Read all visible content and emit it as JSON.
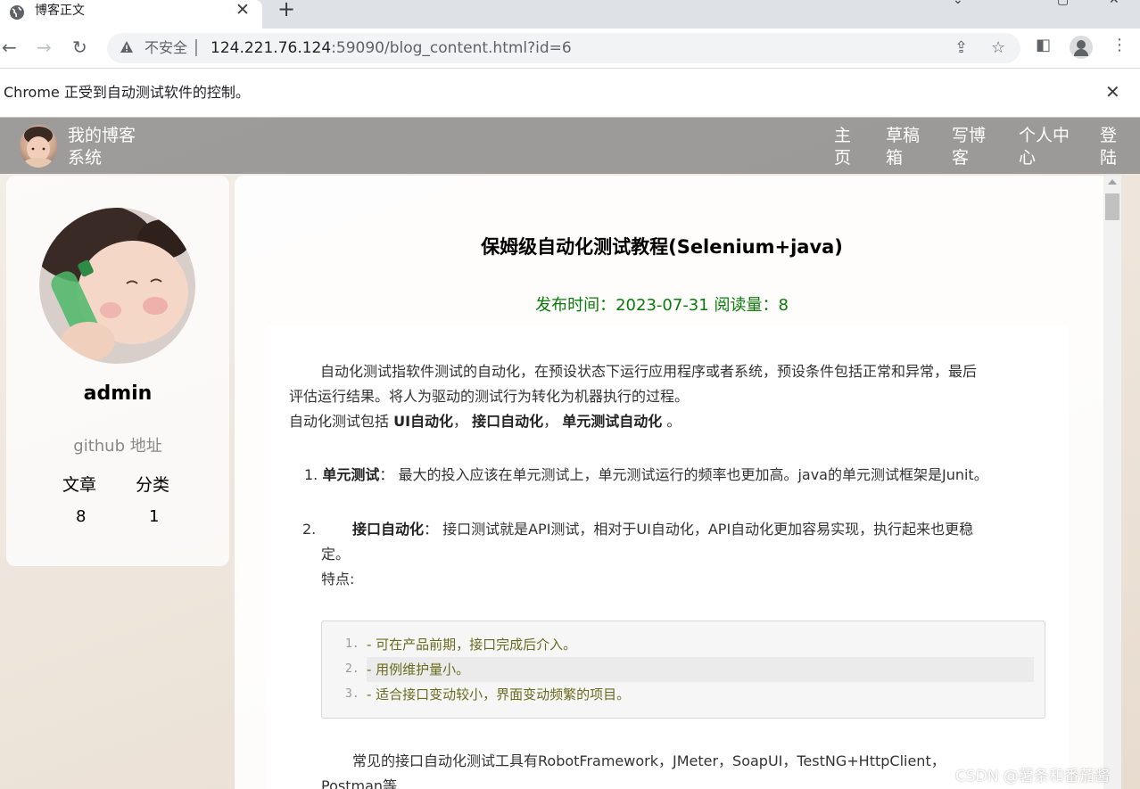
{
  "browser": {
    "tab_title": "博客正文",
    "tab_close": "✕",
    "new_tab": "+",
    "insecure_label": "不安全",
    "url_host": "124.221.76.124",
    "url_rest": ":59090/blog_content.html?id=6",
    "infobar_text": "Chrome 正受到自动测试软件的控制。",
    "infobar_close": "✕"
  },
  "nav": {
    "title": "我的博客系统",
    "links": [
      "主页",
      "草稿箱",
      "写博客",
      "个人中心",
      "登陆"
    ]
  },
  "profile": {
    "username": "admin",
    "github_label": "github 地址",
    "stats": [
      {
        "label": "文章",
        "value": "8"
      },
      {
        "label": "分类",
        "value": "1"
      }
    ]
  },
  "article": {
    "title": "保姆级自动化测试教程(Selenium+java)",
    "meta": "发布时间：2023-07-31   阅读量：8",
    "intro1": "自动化测试指软件测试的自动化，在预设状态下运行应用程序或者系统，预设条件包括正常和异常，最后",
    "intro2": "评估运行结果。将人为驱动的测试行为转化为机器执行的过程。",
    "intro3_prefix": "自动化测试包括 ",
    "intro3_b1": "UI自动化",
    "intro3_sep1": "， ",
    "intro3_b2": "接口自动化",
    "intro3_sep2": "， ",
    "intro3_b3": "单元测试自动化",
    "intro3_end": " 。",
    "item1_num": "1.",
    "item1_bold": "单元测试",
    "item1_text": "： 最大的投入应该在单元测试上，单元测试运行的频率也更加高。java的单元测试框架是Junit。",
    "item2_num": "2.",
    "item2_bold": "接口自动化",
    "item2_text": "： 接口测试就是API测试，相对于UI自动化，API自动化更加容易实现，执行起来也更稳",
    "item2_text2": "定。",
    "features_label": "特点:",
    "code_lines": [
      {
        "num": "1.",
        "text": "- 可在产品前期，接口完成后介入。"
      },
      {
        "num": "2.",
        "text": "- 用例维护量小。"
      },
      {
        "num": "3.",
        "text": "- 适合接口变动较小，界面变动频繁的项目。"
      }
    ],
    "tools1": "常见的接口自动化测试工具有RobotFramework，JMeter，SoapUI，TestNG+HttpClient，",
    "tools2": "Postman等"
  },
  "watermark": "CSDN @薯条和番茄酱",
  "colors": {
    "nav_bg": "#808080",
    "meta_green": "#0a7a0a",
    "code_text": "#6b6b1f"
  }
}
